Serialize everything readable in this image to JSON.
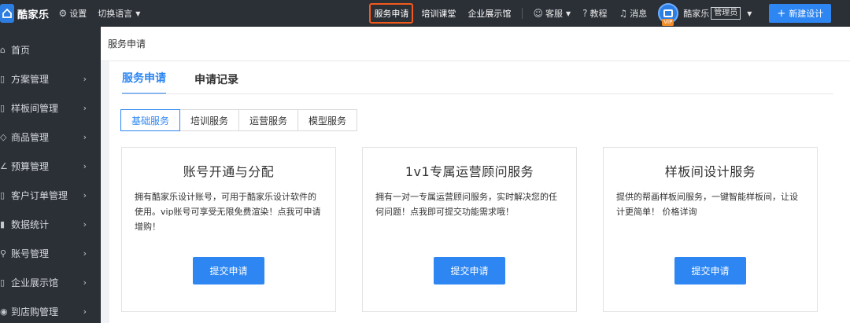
{
  "topbar": {
    "brand": "酷家乐",
    "settings": "设置",
    "language": "切换语言",
    "center_links": [
      "服务申请",
      "培训课堂",
      "企业展示馆"
    ],
    "support": "客服",
    "tutorial": "教程",
    "messages": "消息",
    "vip_badge": "VIP",
    "user_name": "酷家乐",
    "role": "管理员",
    "new_design": "新建设计"
  },
  "sidebar": {
    "items": [
      {
        "label": "首页",
        "icon": "home-icon"
      },
      {
        "label": "方案管理",
        "icon": "document-icon"
      },
      {
        "label": "样板间管理",
        "icon": "document-icon"
      },
      {
        "label": "商品管理",
        "icon": "tag-icon"
      },
      {
        "label": "预算管理",
        "icon": "pen-icon"
      },
      {
        "label": "客户订单管理",
        "icon": "document-icon"
      },
      {
        "label": "数据统计",
        "icon": "chart-icon"
      },
      {
        "label": "账号管理",
        "icon": "user-icon"
      },
      {
        "label": "企业展示馆",
        "icon": "document-icon"
      },
      {
        "label": "到店购管理",
        "icon": "location-icon"
      }
    ]
  },
  "breadcrumb": "服务申请",
  "main": {
    "tabs": [
      "服务申请",
      "申请记录"
    ],
    "subtabs": [
      "基础服务",
      "培训服务",
      "运营服务",
      "模型服务"
    ],
    "cards": [
      {
        "title": "账号开通与分配",
        "desc": "拥有酷家乐设计账号，可用于酷家乐设计软件的使用。vip账号可享受无限免费渲染！点我可申请增购！",
        "button": "提交申请"
      },
      {
        "title": "1v1专属运营顾问服务",
        "desc": "拥有一对一专属运营顾问服务，实时解决您的任何问题！点我即可提交功能需求哦！",
        "button": "提交申请"
      },
      {
        "title": "样板间设计服务",
        "desc": "提供的帮画样板间服务，一键智能样板间，让设计更简单！ 价格详询",
        "button": "提交申请"
      }
    ]
  },
  "colors": {
    "accent": "#2d86f2",
    "topbar": "#2b2f36",
    "highlight": "#f25a1c"
  }
}
